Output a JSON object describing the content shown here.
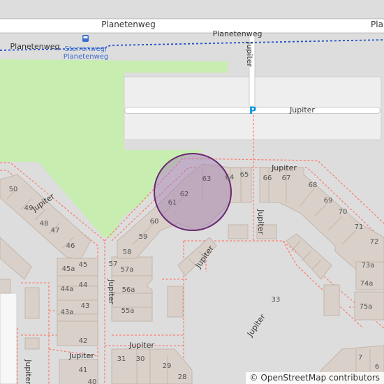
{
  "map": {
    "streets": {
      "planetenweg_main": "Planetenweg",
      "planetenweg_right": "Planetenweg",
      "planetenweg_left": "Planetenweg",
      "planetenweg_path": "Planetenweg",
      "jupiter_vertical": "Jupiter",
      "jupiter_parking_road": "Jupiter",
      "jupiter_top": "Jupiter",
      "jupiter_left_diag": "Jupiter",
      "jupiter_right_vertical": "Jupiter",
      "jupiter_inner_diag": "Jupiter",
      "jupiter_left_vertical": "Jupiter",
      "jupiter_bottom_diag": "Jupiter",
      "jupiter_bottom": "Jupiter",
      "jupiter_bottom_left": "Jupiter",
      "jupiter_far_left": "Jupiter"
    },
    "bus_stop": {
      "icon": "bus-icon",
      "line1": "Sterrenweg/",
      "line2": "Planetenweg"
    },
    "parking_label": "P",
    "house_numbers": {
      "n50": "50",
      "n49": "49",
      "n48": "48",
      "n47": "47",
      "n46": "46",
      "n45a": "45a",
      "n45": "45",
      "n44a": "44a",
      "n44": "44",
      "n43a": "43a",
      "n43": "43",
      "n42": "42",
      "n41": "41",
      "n40": "40",
      "n57": "57",
      "n57a": "57a",
      "n56a": "56a",
      "n55a": "55a",
      "n58": "58",
      "n59": "59",
      "n60": "60",
      "n61": "61",
      "n62": "62",
      "n63": "63",
      "n64": "64",
      "n65": "65",
      "n66": "66",
      "n67": "67",
      "n68": "68",
      "n69": "69",
      "n70": "70",
      "n71": "71",
      "n72": "72",
      "n73a": "73a",
      "n74a": "74a",
      "n75a": "75a",
      "n33": "33",
      "n31": "31",
      "n30": "30",
      "n29": "29",
      "n28": "28",
      "n7": "7",
      "n6": "6"
    },
    "attribution": {
      "symbol": "©",
      "text": "OpenStreetMap contributors"
    },
    "colors": {
      "background": "#dddddd",
      "road": "#ffffff",
      "road_casing": "#c8c8c8",
      "building": "#d9d0c9",
      "building_outline": "#c4b6ab",
      "park": "#c8edb0",
      "parking": "#eeeeee",
      "footway": "#fa8072",
      "bus_route": "#2050c8",
      "marker_fill": "#a07ab0",
      "marker_stroke": "#6a2a70",
      "text": "#333333",
      "bus_text": "#3a6fd0",
      "parking_text": "#0092da"
    }
  }
}
